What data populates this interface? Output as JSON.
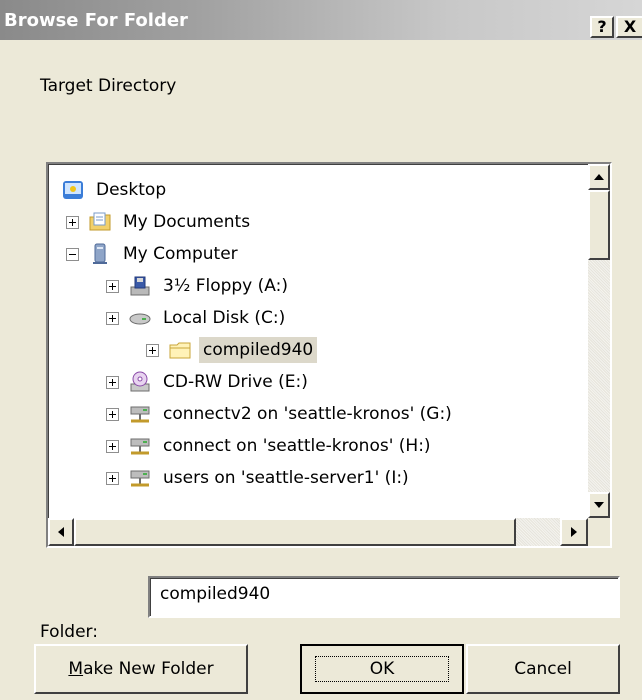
{
  "window": {
    "title": "Browse For Folder",
    "help_label": "?",
    "close_label": "X"
  },
  "prompt": "Target Directory",
  "tree": {
    "items": [
      {
        "label": "Desktop",
        "icon": "desktop-icon",
        "expander": "none",
        "selected": false
      },
      {
        "label": "My Documents",
        "icon": "documents-folder-icon",
        "expander": "plus",
        "selected": false
      },
      {
        "label": "My Computer",
        "icon": "computer-icon",
        "expander": "minus",
        "selected": false
      },
      {
        "label": "3½ Floppy (A:)",
        "icon": "floppy-drive-icon",
        "expander": "plus",
        "selected": false
      },
      {
        "label": "Local Disk (C:)",
        "icon": "hard-disk-icon",
        "expander": "plus",
        "selected": false
      },
      {
        "label": "compiled940",
        "icon": "folder-icon",
        "expander": "plus",
        "selected": true
      },
      {
        "label": "CD-RW Drive (E:)",
        "icon": "cd-drive-icon",
        "expander": "plus",
        "selected": false
      },
      {
        "label": "connectv2 on 'seattle-kronos' (G:)",
        "icon": "network-drive-icon",
        "expander": "plus",
        "selected": false
      },
      {
        "label": "connect on 'seattle-kronos' (H:)",
        "icon": "network-drive-icon",
        "expander": "plus",
        "selected": false
      },
      {
        "label": "users on 'seattle-server1' (I:)",
        "icon": "network-drive-icon",
        "expander": "plus",
        "selected": false
      }
    ]
  },
  "folder": {
    "label": "Folder:",
    "value": "compiled940"
  },
  "buttons": {
    "make_new_folder_mnemonic": "M",
    "make_new_folder_rest": "ake New Folder",
    "ok": "OK",
    "cancel": "Cancel"
  }
}
